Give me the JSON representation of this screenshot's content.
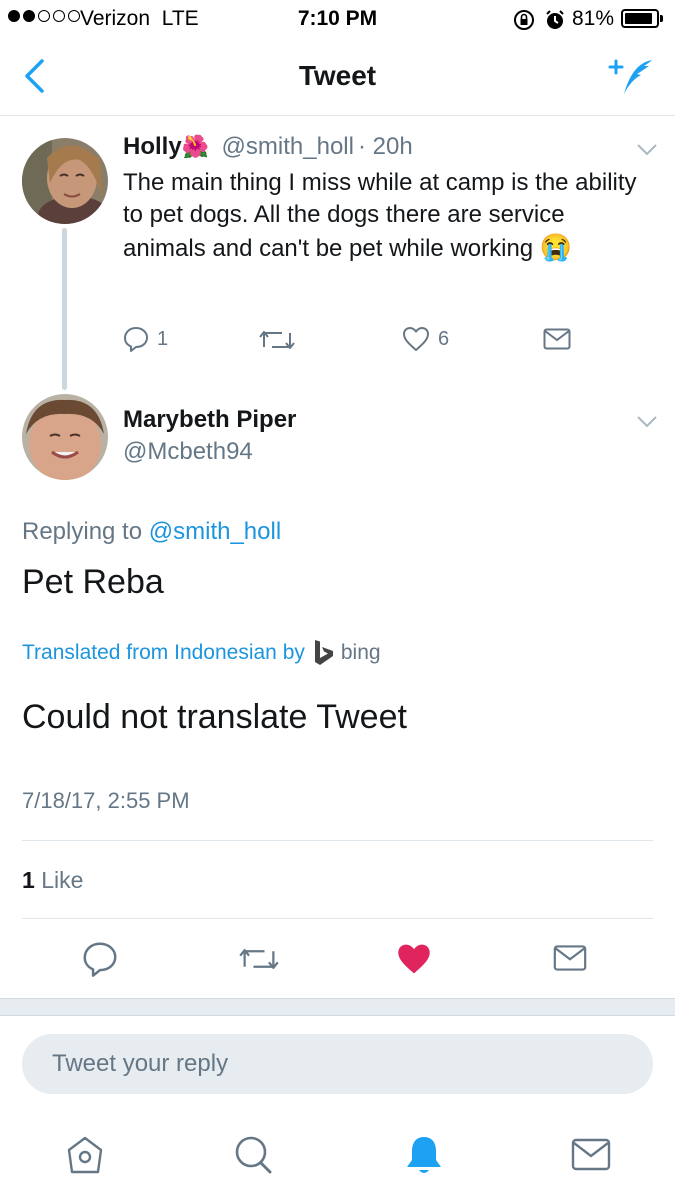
{
  "status_bar": {
    "carrier": "Verizon",
    "network": "LTE",
    "time": "7:10 PM",
    "battery": "81%",
    "battery_level": 0.81,
    "icons": [
      "signal-dots",
      "orientation-lock-icon",
      "alarm-icon",
      "battery-icon"
    ]
  },
  "nav": {
    "title": "Tweet",
    "back_icon": "chevron-left-icon",
    "compose_icon": "compose-tweet-icon",
    "accent": "#1da1f2"
  },
  "parent_tweet": {
    "name": "Holly",
    "name_emoji": "🌺",
    "handle": "@smith_holl",
    "time": "· 20h",
    "text": "The main thing I miss while at camp is the ability to pet dogs. All the dogs there are service animals and can't be pet while working",
    "emoji": "😭",
    "reply_count": "1",
    "like_count": "6"
  },
  "main_tweet": {
    "name": "Marybeth Piper",
    "handle": "@Mcbeth94",
    "replying_prefix": "Replying to",
    "replying_handle": "@smith_holl",
    "text": "Pet Reba",
    "translated_label": "Translated from Indonesian by",
    "translator": "bing",
    "translation": "Could not translate Tweet",
    "timestamp": "7/18/17, 2:55 PM",
    "like_count": "1",
    "like_label": "Like",
    "liked": true,
    "like_color": "#e0245e"
  },
  "reply_box": {
    "placeholder": "Tweet your reply"
  },
  "tab_bar": {
    "items": [
      "home-icon",
      "search-icon",
      "notifications-icon",
      "messages-icon"
    ],
    "active": "notifications-icon"
  }
}
